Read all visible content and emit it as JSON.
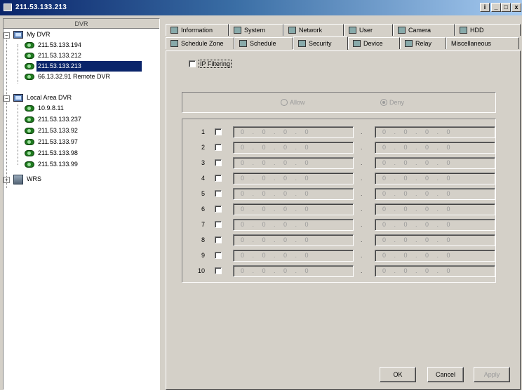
{
  "window": {
    "title": "211.53.133.213",
    "min_label": "_",
    "max_label": "□",
    "close_label": "x",
    "help_label": "i"
  },
  "left_panel": {
    "header": "DVR",
    "groups": [
      {
        "label": "My DVR",
        "icon": "dvr-group-icon"
      },
      {
        "label": "Local Area DVR",
        "icon": "lan-group-icon"
      },
      {
        "label": "WRS",
        "icon": "server-icon"
      }
    ],
    "my_dvr_items": [
      "211.53.133.194",
      "211.53.133.212",
      "211.53.133.213",
      "66.13.32.91 Remote DVR"
    ],
    "lan_items": [
      "10.9.8.11",
      "211.53.133.237",
      "211.53.133.92",
      "211.53.133.97",
      "211.53.133.98",
      "211.53.133.99"
    ],
    "selected": "211.53.133.213"
  },
  "tabs": {
    "row1": [
      "Information",
      "System",
      "Network",
      "User",
      "Camera",
      "HDD"
    ],
    "row2": [
      "Schedule Zone",
      "Schedule",
      "Security",
      "Device",
      "Relay",
      "Miscellaneous"
    ],
    "active": "Security"
  },
  "security": {
    "ip_filtering_label": "IP Filtering",
    "ip_filtering_checked": false,
    "allow_label": "Allow",
    "deny_label": "Deny",
    "deny_selected": true,
    "row_numbers": [
      "1",
      "2",
      "3",
      "4",
      "5",
      "6",
      "7",
      "8",
      "9",
      "10"
    ],
    "ip_placeholder": "0 . 0 . 0 . 0",
    "range_separator": "."
  },
  "buttons": {
    "ok": "OK",
    "cancel": "Cancel",
    "apply": "Apply"
  }
}
